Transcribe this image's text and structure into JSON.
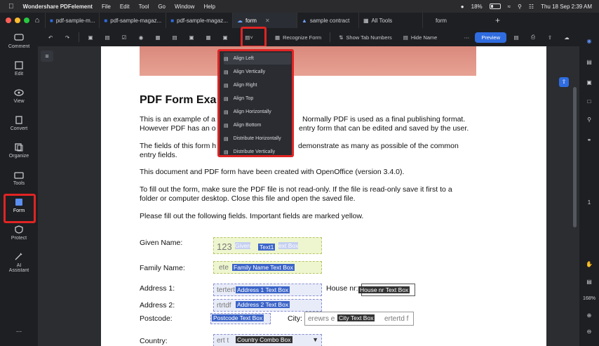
{
  "menubar": {
    "app": "Wondershare PDFelement",
    "menus": [
      "File",
      "Edit",
      "Tool",
      "Go",
      "Window",
      "Help"
    ],
    "battery": "18%",
    "datetime": "Thu 18 Sep  2:39 AM"
  },
  "tabs": [
    {
      "label": "pdf-sample-m..."
    },
    {
      "label": "pdf-sample-magaz..."
    },
    {
      "label": "pdf-sample-magaz..."
    },
    {
      "label": "form",
      "active": true
    },
    {
      "label": "sample contract"
    },
    {
      "label": "All Tools"
    },
    {
      "label": "form"
    }
  ],
  "sidebar": [
    {
      "label": "Comment",
      "icon": "comment-icon"
    },
    {
      "label": "Edit",
      "icon": "edit-icon"
    },
    {
      "label": "View",
      "icon": "view-icon"
    },
    {
      "label": "Convert",
      "icon": "convert-icon"
    },
    {
      "label": "Organize",
      "icon": "organize-icon"
    },
    {
      "label": "Tools",
      "icon": "tools-icon"
    },
    {
      "label": "Form",
      "icon": "form-icon",
      "active": true
    },
    {
      "label": "Protect",
      "icon": "protect-icon"
    },
    {
      "label": "AI",
      "icon": "ai-assistant-icon"
    },
    {
      "label": "Assistant"
    },
    {
      "label": "..."
    }
  ],
  "toolbar": {
    "recognize": "Recognize Form",
    "tab_numbers": "Show Tab Numbers",
    "hide_name": "Hide Name",
    "preview": "Preview"
  },
  "align_menu": [
    "Align Left",
    "Align Vertically",
    "Align Right",
    "Align Top",
    "Align Horizontally",
    "Align Bottom",
    "Distribute Horizontally",
    "Distribute Vertically"
  ],
  "doc": {
    "title": "PDF Form Exa",
    "p1a": "This is an example of a",
    "p1b": "Normally PDF is used as a final publishing format.",
    "p1c": "However PDF has an o",
    "p1d": "entry form that can be edited and saved by the user.",
    "p2a": "The fields of this form h",
    "p2b": "demonstrate as many as possible of the common",
    "p2c": "entry fields.",
    "p3": "This document and PDF form have been created with OpenOffice (version 3.4.0).",
    "p4a": "To fill out the form, make sure the PDF file is not read-only. If the file is read-only save it first to a",
    "p4b": "folder or computer desktop. Close this file and open the saved file.",
    "p5": "Please fill out the following fields. Important fields are marked yellow.",
    "labels": {
      "given": "Given Name:",
      "family": "Family Name:",
      "addr1": "Address 1:",
      "addr2": "Address 2:",
      "postcode": "Postcode:",
      "city": "City:",
      "house": "House nr:",
      "country": "Country:"
    },
    "fields": {
      "given_val": "123",
      "given_ghost": "Given",
      "given_tag": "Text1",
      "given_ghost2": "ext Box",
      "family_val": "ete",
      "family_tag": "Family Name Text Box",
      "addr1_val": "tertert",
      "addr1_tag": "Address 1 Text Box",
      "addr2_val": "rtrtdf",
      "addr2_tag": "Address 2 Text Box",
      "postcode_tag": "Postcode Text Box",
      "house_tag": "House nr Text Box",
      "city_val": "erewrs e",
      "city_tag": "City Text Box",
      "city_val2": "ertertd f",
      "country_tag": "Country Combo Box",
      "country_val": "ert t"
    }
  },
  "right": {
    "page": "1",
    "zoom": "168%"
  }
}
